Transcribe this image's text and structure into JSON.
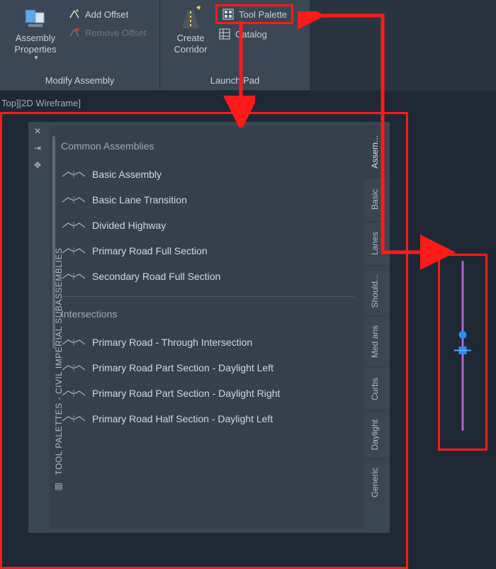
{
  "ribbon": {
    "groups": {
      "modify": {
        "label": "Modify Assembly",
        "assembly_props": "Assembly\nProperties",
        "add_offset": "Add Offset",
        "remove_offset": "Remove Offset"
      },
      "launch": {
        "label": "Launch Pad",
        "create_corridor": "Create\nCorridor",
        "tool_palette": "Tool Palette",
        "catalog": "Catalog"
      }
    }
  },
  "viewport_label": "Top][2D Wireframe]",
  "palette": {
    "title": "TOOL PALETTES - CIVIL IMPERIAL SUBASSEMBLIES",
    "tabs": [
      "Assem...",
      "Basic",
      "Lanes",
      "Should...",
      "Med ans",
      "Curbs",
      "Daylight",
      "Generic"
    ],
    "active_tab": 0,
    "groups": [
      {
        "header": "Common Assemblies",
        "items": [
          "Basic Assembly",
          "Basic Lane Transition",
          "Divided Highway",
          "Primary Road Full Section",
          "Secondary Road Full Section"
        ]
      },
      {
        "header": "Intersections",
        "items": [
          "Primary Road - Through Intersection",
          "Primary Road Part Section - Daylight Left",
          "Primary Road Part Section - Daylight Right",
          "Primary Road Half Section - Daylight Left"
        ]
      }
    ]
  },
  "colors": {
    "accent_red": "#ff1a1a",
    "marker_blue": "#1e90ff",
    "marker_line": "#b56fcf"
  }
}
